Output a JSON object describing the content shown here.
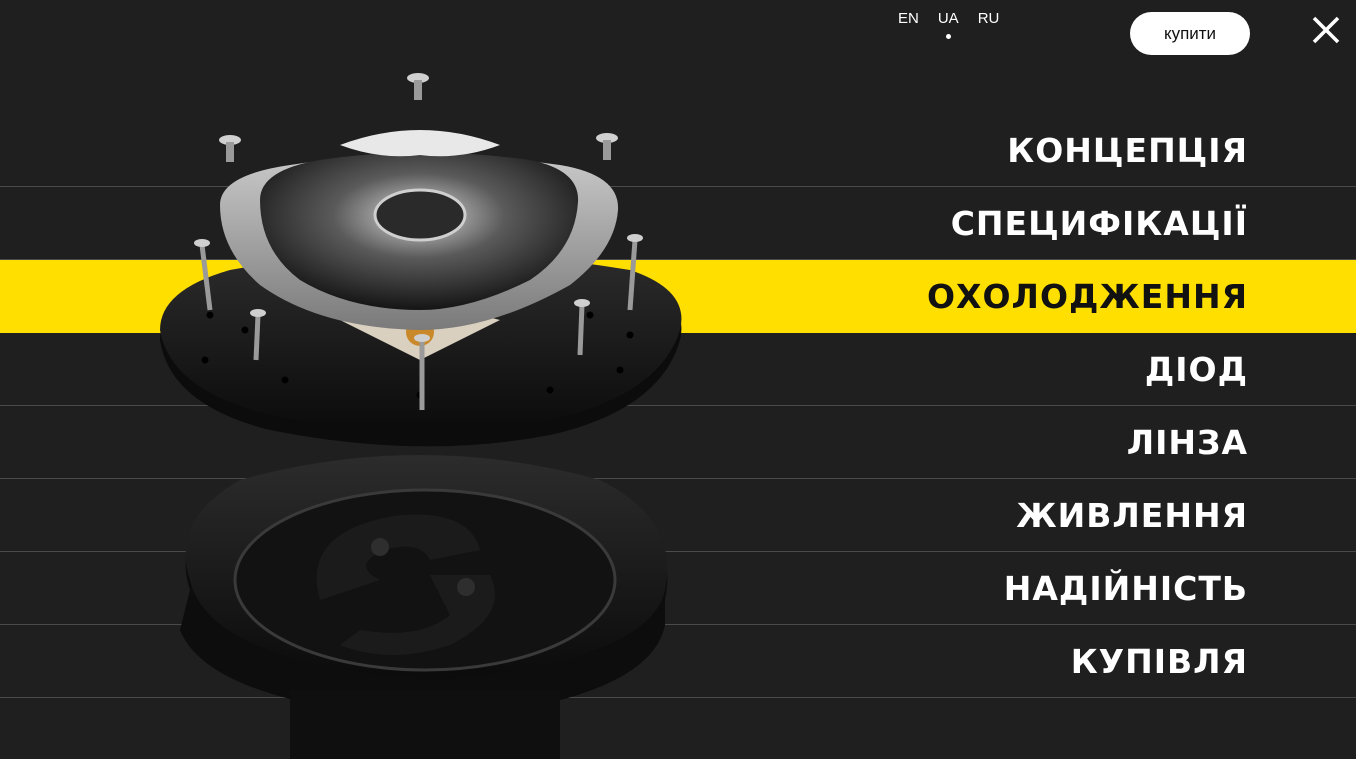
{
  "header": {
    "languages": [
      {
        "code": "EN",
        "active": false
      },
      {
        "code": "UA",
        "active": true
      },
      {
        "code": "RU",
        "active": false
      }
    ],
    "buy_label": "купити",
    "close_icon": "close-icon"
  },
  "menu": {
    "active_index": 2,
    "items": [
      {
        "label": "КОНЦЕПЦІЯ"
      },
      {
        "label": "СПЕЦИФІКАЦІЇ"
      },
      {
        "label": "ОХОЛОДЖЕННЯ"
      },
      {
        "label": "ДІОД"
      },
      {
        "label": "ЛІНЗА"
      },
      {
        "label": "ЖИВЛЕННЯ"
      },
      {
        "label": "НАДІЙНІСТЬ"
      },
      {
        "label": "КУПІВЛЯ"
      }
    ]
  },
  "colors": {
    "background": "#1f1f1f",
    "accent": "#ffdf00",
    "divider": "#4a4a4a",
    "text": "#ffffff"
  }
}
